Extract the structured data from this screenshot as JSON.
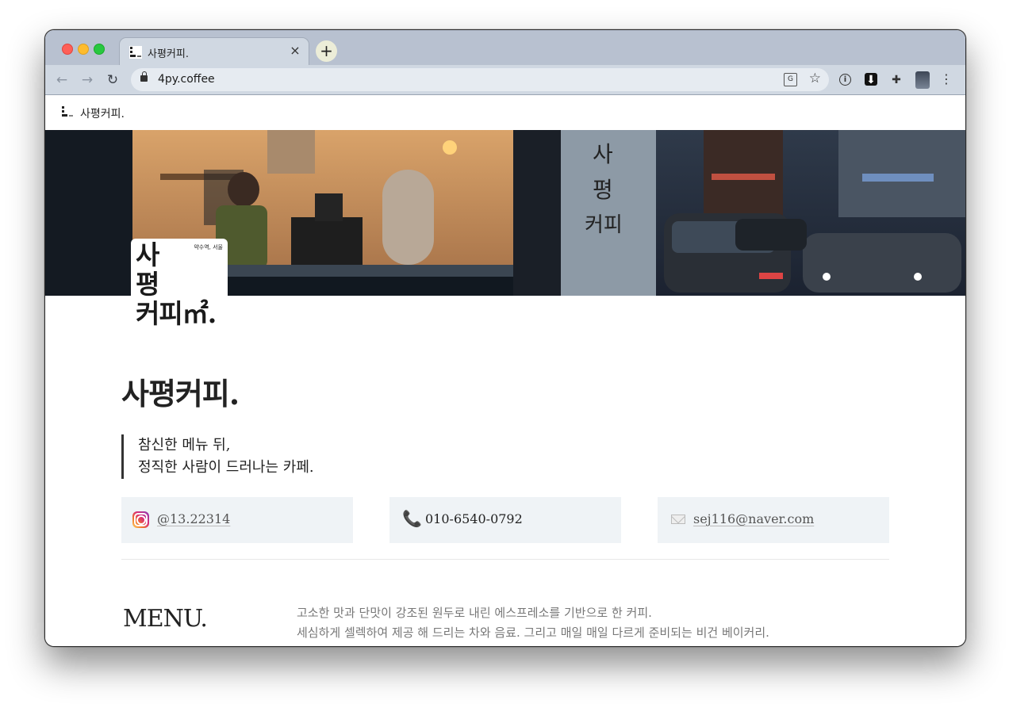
{
  "browser": {
    "tab_title": "사평커피.",
    "tab_close": "×",
    "new_tab": "+",
    "url": "4py.coffee",
    "back": "←",
    "forward": "→",
    "reload": "↻",
    "star": "☆",
    "translate": "G",
    "menu": "⋮",
    "ext_info": "i",
    "ext_download": "⬇",
    "ext_puzzle": "✚"
  },
  "site": {
    "topbar_name": "사평커피.",
    "logo_small": "약수역, 서울",
    "logo_line1": "사",
    "logo_line2": "평",
    "logo_line3": "커피㎡.",
    "title": "사평커피.",
    "quote_lines": [
      "참신한 메뉴 뒤,",
      "정직한 사람이 드러나는 카페."
    ],
    "contacts": {
      "instagram": "@13.22314",
      "phone": "010-6540-0792",
      "email": "sej116@naver.com"
    },
    "menu": {
      "heading": "MENU.",
      "desc_lines": [
        "고소한 맛과 단맛이 강조된 원두로 내린 에스프레소를 기반으로 한 커피.",
        "세심하게 셀렉하여 제공 해 드리는 차와 음료. 그리고 매일 매일 다르게 준비되는 비건 베이커리."
      ]
    }
  },
  "icons": {
    "phone": "📞"
  }
}
